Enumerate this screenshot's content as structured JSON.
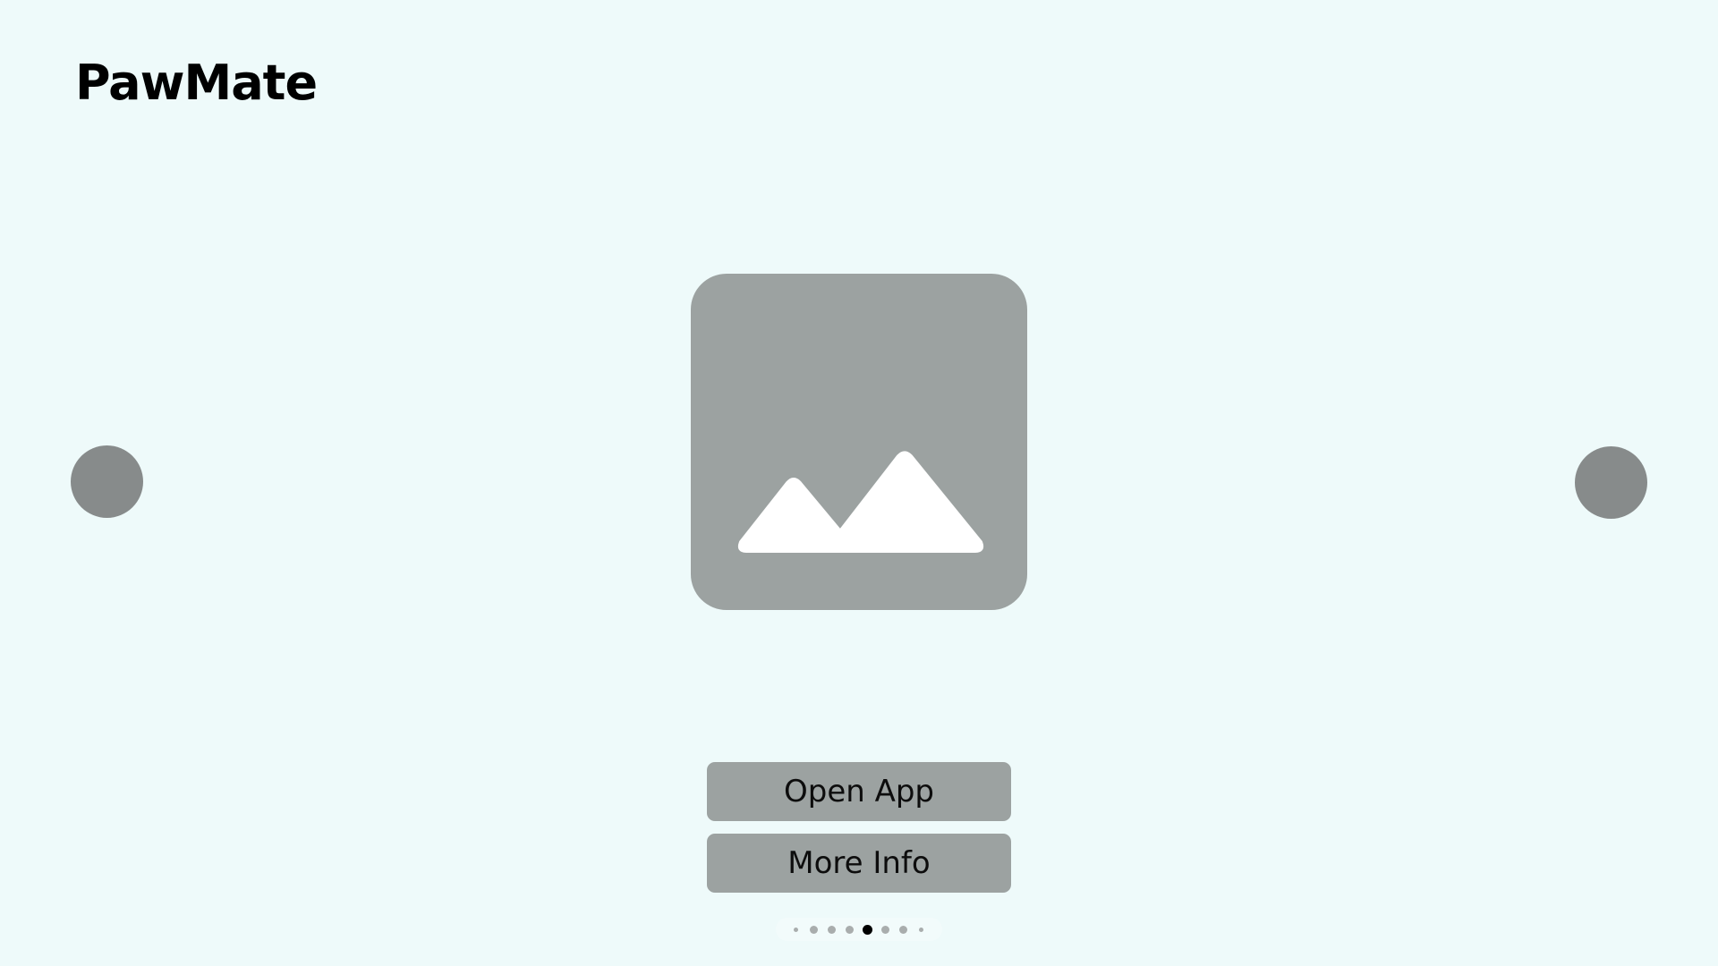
{
  "app": {
    "title": "PawMate"
  },
  "hero": {
    "icon": "image-placeholder-icon"
  },
  "navigation": {
    "previous_icon": "circle-prev-icon",
    "next_icon": "circle-next-icon"
  },
  "actions": {
    "open_app_label": "Open App",
    "more_info_label": "More Info"
  },
  "pagination": {
    "total_pages": 8,
    "current_page": 5
  },
  "colors": {
    "background": "#eefafa",
    "placeholder": "#9ca2a1",
    "nav_button": "#878b8b",
    "dot_active": "#000000",
    "dot_inactive": "#a9adad"
  }
}
